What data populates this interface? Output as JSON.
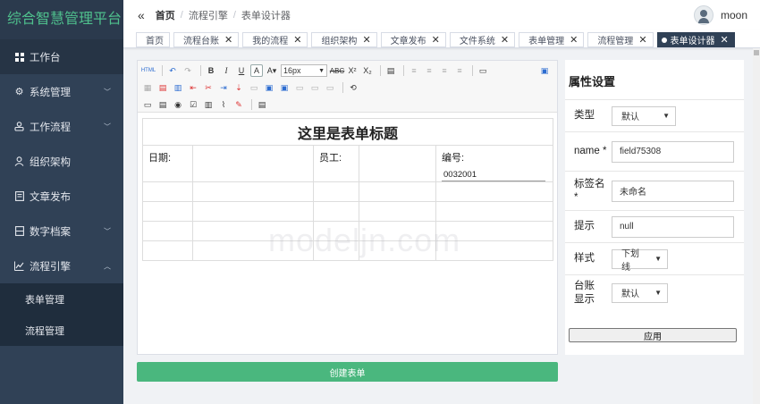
{
  "app": {
    "title": "综合智慧管理平台"
  },
  "sidebar": {
    "items": [
      {
        "label": "工作台",
        "icon": "dashboard-icon",
        "active": true
      },
      {
        "label": "系统管理",
        "icon": "gear-icon",
        "has_children": true
      },
      {
        "label": "工作流程",
        "icon": "workflow-icon",
        "has_children": true
      },
      {
        "label": "组织架构",
        "icon": "user-icon"
      },
      {
        "label": "文章发布",
        "icon": "document-icon"
      },
      {
        "label": "数字档案",
        "icon": "archive-icon",
        "has_children": true
      },
      {
        "label": "流程引擎",
        "icon": "chart-icon",
        "has_children": true,
        "expanded": true
      }
    ],
    "sub_items": [
      {
        "label": "表单管理"
      },
      {
        "label": "流程管理"
      }
    ]
  },
  "breadcrumb": [
    "首页",
    "流程引擎",
    "表单设计器"
  ],
  "user": {
    "name": "moon"
  },
  "tabs": [
    {
      "label": "首页",
      "closable": false
    },
    {
      "label": "流程台账",
      "closable": true
    },
    {
      "label": "我的流程",
      "closable": true
    },
    {
      "label": "组织架构",
      "closable": true
    },
    {
      "label": "文章发布",
      "closable": true
    },
    {
      "label": "文件系统",
      "closable": true
    },
    {
      "label": "表单管理",
      "closable": true
    },
    {
      "label": "流程管理",
      "closable": true
    },
    {
      "label": "表单设计器",
      "closable": true,
      "active": true
    }
  ],
  "editor": {
    "font_size": "16px",
    "form": {
      "title": "这里是表单标题",
      "date_label": "日期:",
      "staff_label": "员工:",
      "code_label": "编号:",
      "code_value": "0032001"
    },
    "watermark": "modeljn.com"
  },
  "create_button": {
    "label": "创建表单"
  },
  "properties": {
    "title": "属性设置",
    "type": {
      "label": "类型",
      "value": "默认"
    },
    "name": {
      "label": "name *",
      "value": "field75308"
    },
    "tag_name": {
      "label": "标签名 *",
      "value": "未命名"
    },
    "hint": {
      "label": "提示",
      "value": "null"
    },
    "style": {
      "label": "样式",
      "value": "下划线"
    },
    "ledger_display": {
      "label": "台账显示",
      "value": "默认"
    },
    "apply_label": "应用"
  },
  "colors": {
    "sidebar_bg": "#304156",
    "brand": "#4fc08d",
    "active_tab": "#304156",
    "create_button": "#4ab77e"
  }
}
